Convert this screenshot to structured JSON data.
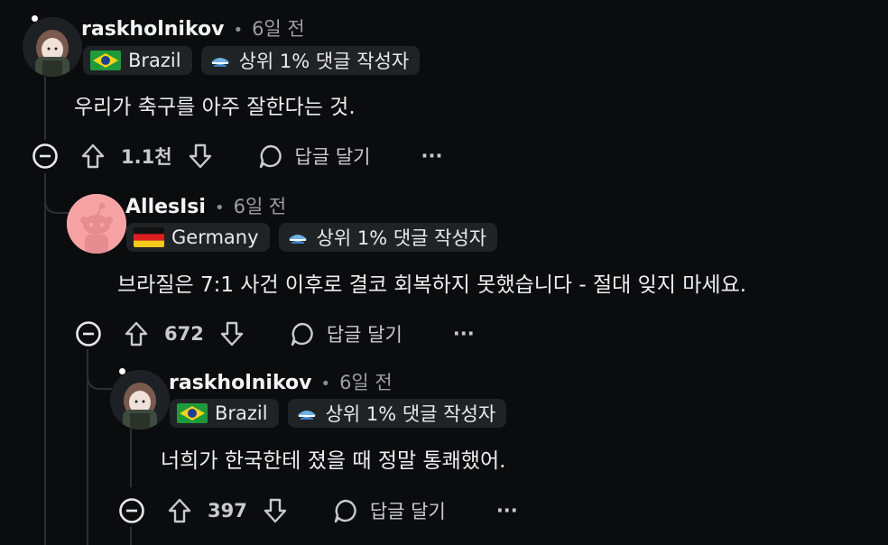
{
  "comments": [
    {
      "username": "raskholnikov",
      "time": "6일 전",
      "flair_country": "Brazil",
      "flair_badge": "상위 1% 댓글 작성자",
      "text": "우리가 축구를 아주 잘한다는 것.",
      "votes": "1.1천",
      "reply_label": "답글 달기",
      "more_label": "···"
    },
    {
      "username": "AllesIsi",
      "time": "6일 전",
      "flair_country": "Germany",
      "flair_badge": "상위 1% 댓글 작성자",
      "text": "브라질은 7:1 사건 이후로 결코 회복하지 못했습니다 - 절대 잊지 마세요.",
      "votes": "672",
      "reply_label": "답글 달기",
      "more_label": "···"
    },
    {
      "username": "raskholnikov",
      "time": "6일 전",
      "flair_country": "Brazil",
      "flair_badge": "상위 1% 댓글 작성자",
      "text": "너희가 한국한테 졌을 때 정말 통쾌했어.",
      "votes": "397",
      "reply_label": "답글 달기",
      "more_label": "···"
    }
  ],
  "colors": {
    "background": "#0b0c0e",
    "flair_bg": "#202326",
    "thread_line": "#2c3034",
    "german_avatar_bg": "#f7a3a6"
  }
}
